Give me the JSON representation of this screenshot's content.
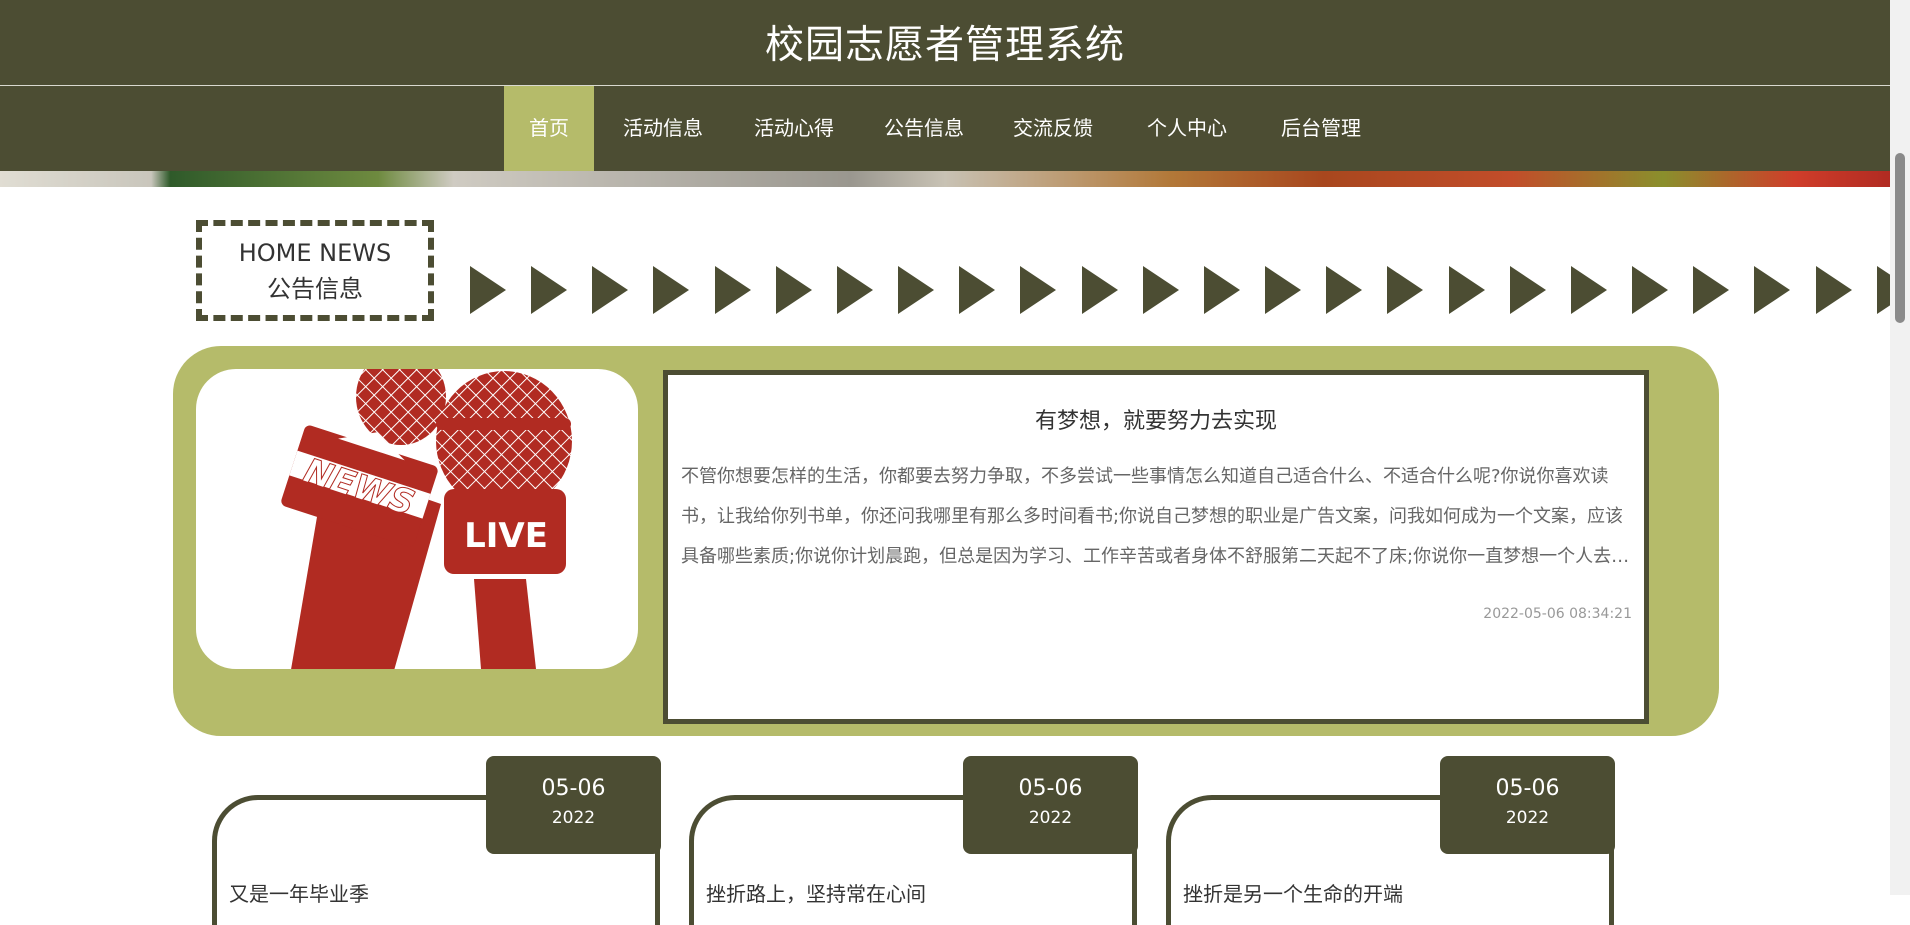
{
  "header": {
    "title": "校园志愿者管理系统"
  },
  "nav": {
    "items": [
      {
        "label": "首页",
        "active": true
      },
      {
        "label": "活动信息"
      },
      {
        "label": "活动心得"
      },
      {
        "label": "公告信息"
      },
      {
        "label": "交流反馈"
      },
      {
        "label": "个人中心"
      },
      {
        "label": "后台管理"
      }
    ]
  },
  "section": {
    "title_en": "HOME NEWS",
    "title_cn": "公告信息"
  },
  "featured": {
    "title": "有梦想，就要努力去实现",
    "text": "不管你想要怎样的生活，你都要去努力争取，不多尝试一些事情怎么知道自己适合什么、不适合什么呢?你说你喜欢读书，让我给你列书单，你还问我哪里有那么多时间看书;你说自己梦想的职业是广告文案，问我如何成为一个文案，应该具备哪些素质;你说你计划晨跑，但总是因为学习、工作辛苦或者身体不舒服第二天起不了床;你说你一直梦想一个人去长途旅行，有时间没钱，有钱没时间……",
    "date": "2022-05-06 08:34:21",
    "image": {
      "mic_left_label": "NEWS",
      "mic_right_label": "LIVE"
    }
  },
  "news": [
    {
      "day": "05-06",
      "year": "2022",
      "title": "又是一年毕业季"
    },
    {
      "day": "05-06",
      "year": "2022",
      "title": "挫折路上，坚持常在心间"
    },
    {
      "day": "05-06",
      "year": "2022",
      "title": "挫折是另一个生命的开端"
    }
  ],
  "colors": {
    "primary": "#4c4d33",
    "accent": "#b5bb6a",
    "mic_red": "#b12b22"
  }
}
